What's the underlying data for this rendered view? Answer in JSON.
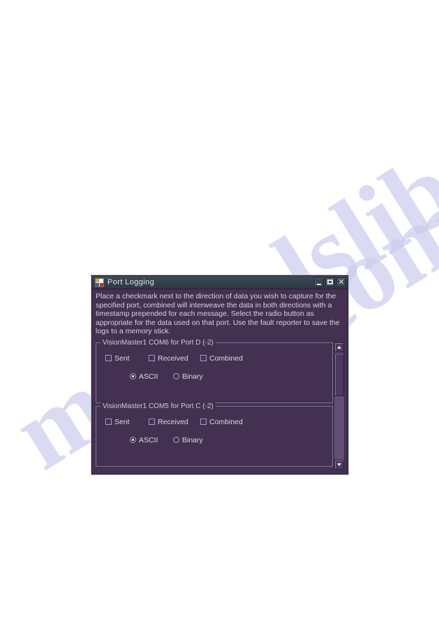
{
  "page": {
    "watermark_left": "manualslib",
    "watermark_right": "e.com"
  },
  "window": {
    "title": "Port Logging",
    "close_glyph": "✕",
    "description": "Place a checkmark next to the direction of data you wish to capture for the specified port, combined will interweave the data in both directions with a timestamp prepended for each message.  Select the radio button as appropriate for the data used on that port. Use the fault reporter to save the logs to a memory stick."
  },
  "ports": [
    {
      "title": "VisionMaster1 COM6 for Port D (-2)",
      "checkboxes": [
        {
          "label": "Sent",
          "checked": false
        },
        {
          "label": "Received",
          "checked": false
        },
        {
          "label": "Combined",
          "checked": false
        }
      ],
      "radios": [
        {
          "label": "ASCII",
          "selected": true
        },
        {
          "label": "Binary",
          "selected": false
        }
      ]
    },
    {
      "title": "VisionMaster1 COM5 for Port C (-2)",
      "checkboxes": [
        {
          "label": "Sent",
          "checked": false
        },
        {
          "label": "Received",
          "checked": false
        },
        {
          "label": "Combined",
          "checked": false
        }
      ],
      "radios": [
        {
          "label": "ASCII",
          "selected": true
        },
        {
          "label": "Binary",
          "selected": false
        }
      ]
    }
  ],
  "scrollbar": {
    "orientation": "vertical",
    "thumb_position_percent": 0,
    "thumb_size_percent": 38
  },
  "colors": {
    "window_background": "#443152",
    "titlebar": "#34414d",
    "text": "#d4d0e0",
    "group_border": "#7b6f8d",
    "scrollbar_track": "#6a5a7d",
    "watermark": "#ccccef"
  }
}
